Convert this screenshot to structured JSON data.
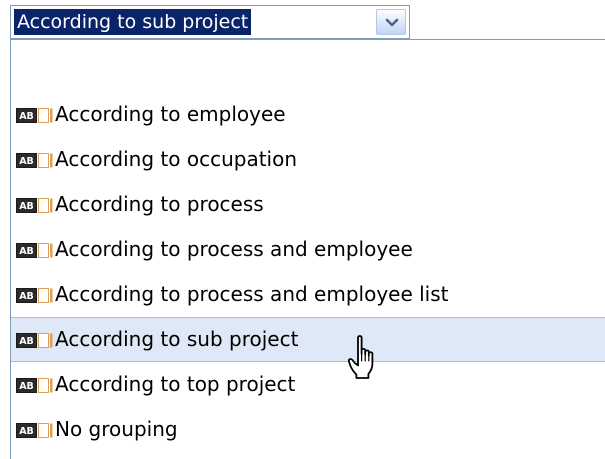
{
  "combobox": {
    "selected_value": "According to sub project",
    "button_icon": "chevron-down-icon"
  },
  "dropdown": {
    "item_icon": "text-field-icon",
    "item_icon_text": "AB",
    "hovered_index": 5,
    "items": [
      {
        "label": "According to employee"
      },
      {
        "label": "According to occupation"
      },
      {
        "label": "According to process"
      },
      {
        "label": "According to process and employee"
      },
      {
        "label": "According to process and employee list"
      },
      {
        "label": "According to sub project"
      },
      {
        "label": "According to top project"
      },
      {
        "label": "No grouping"
      }
    ]
  },
  "cursor": {
    "icon": "hand-pointer-icon"
  },
  "colors": {
    "selection_bg": "#0a246a",
    "selection_text": "#ffffff",
    "hover_bg": "#dfe8f6",
    "hover_border": "#a7bde4",
    "field_border": "#7f9db9"
  }
}
